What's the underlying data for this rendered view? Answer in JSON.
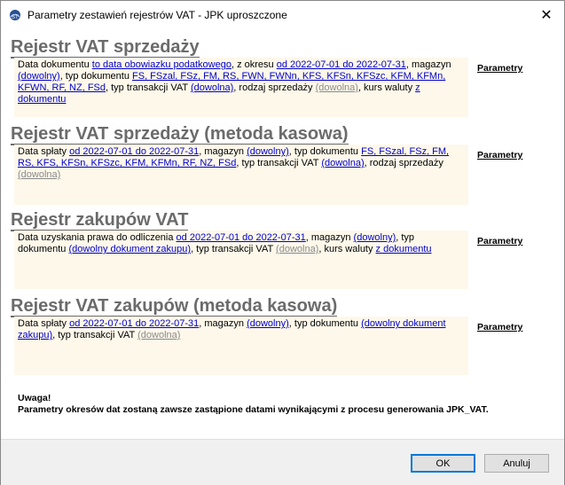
{
  "window": {
    "title": "Parametry zestawień rejestrów VAT - JPK uproszczone",
    "close_glyph": "✕",
    "icon": "app-icon"
  },
  "sections": [
    {
      "title": "Rejestr VAT sprzedaży",
      "params_label": "Parametry",
      "body": {
        "t1": "Data dokumentu ",
        "l1": "to data obowiazku podatkowego",
        "t2": ", z okresu ",
        "l2": "od 2022-07-01 do 2022-07-31",
        "t3": ", magazyn ",
        "l3": "(dowolny)",
        "t4": ", typ dokumentu ",
        "l4": "FS, FSzal, FSz, FM, RS, FWN, FWNn, KFS, KFSn, KFSzc, KFM, KFMn, KFWN, RF, NZ, FSd",
        "t5": ", typ transakcji VAT ",
        "l5": "(dowolna)",
        "t6": ", rodzaj sprzedaży ",
        "l6": "(dowolna)",
        "t7": ", kurs waluty ",
        "l7": "z dokumentu"
      }
    },
    {
      "title": "Rejestr VAT sprzedaży (metoda kasowa)",
      "params_label": "Parametry",
      "body": {
        "t1": "Data spłaty ",
        "l1": "od 2022-07-01 do 2022-07-31",
        "t2": ", magazyn ",
        "l2": "(dowolny)",
        "t3": ", typ dokumentu ",
        "l3": "FS, FSzal, FSz, FM, RS, KFS, KFSn, KFSzc, KFM, KFMn, RF, NZ, FSd",
        "t4": ", typ transakcji VAT ",
        "l4": "(dowolna)",
        "t5": ", rodzaj sprzedaży ",
        "l5": "(dowolna)"
      }
    },
    {
      "title": "Rejestr zakupów VAT",
      "params_label": "Parametry",
      "body": {
        "t1": "Data uzyskania prawa do odliczenia ",
        "l1": "od 2022-07-01 do 2022-07-31",
        "t2": ", magazyn ",
        "l2": "(dowolny)",
        "t3": ", typ dokumentu ",
        "l3": "(dowolny dokument zakupu)",
        "t4": ", typ transakcji VAT ",
        "l4": "(dowolna)",
        "t5": ", kurs waluty ",
        "l5": "z dokumentu"
      }
    },
    {
      "title": "Rejestr VAT zakupów (metoda kasowa)",
      "params_label": "Parametry",
      "body": {
        "t1": "Data spłaty ",
        "l1": "od 2022-07-01 do 2022-07-31",
        "t2": ", magazyn ",
        "l2": "(dowolny)",
        "t3": ", typ dokumentu ",
        "l3": "(dowolny dokument zakupu)",
        "t4": ", typ transakcji VAT ",
        "l4": "(dowolna)"
      }
    }
  ],
  "note": {
    "heading": "Uwaga!",
    "text": "Parametry okresów dat zostaną zawsze zastąpione datami wynikającymi z procesu generowania JPK_VAT."
  },
  "buttons": {
    "ok": "OK",
    "cancel": "Anuluj"
  },
  "colors": {
    "link": "#0000cc",
    "link_grey": "#8a8a8a",
    "title_grey": "#6b6b6b",
    "panel_bg": "#fdf8ea"
  }
}
